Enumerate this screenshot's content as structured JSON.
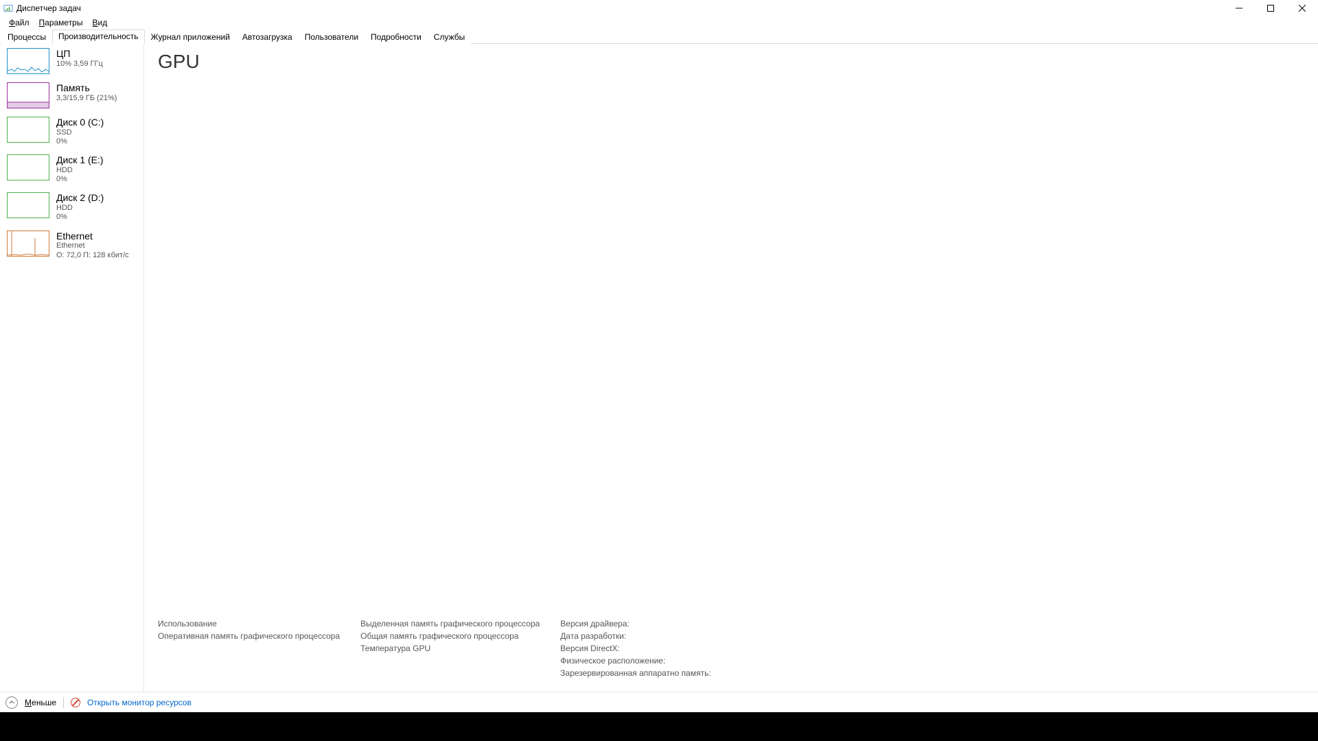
{
  "window": {
    "title": "Диспетчер задач"
  },
  "menu": {
    "file": "Файл",
    "options": "Параметры",
    "view": "Вид"
  },
  "tabs": [
    {
      "label": "Процессы"
    },
    {
      "label": "Производительность"
    },
    {
      "label": "Журнал приложений"
    },
    {
      "label": "Автозагрузка"
    },
    {
      "label": "Пользователи"
    },
    {
      "label": "Подробности"
    },
    {
      "label": "Службы"
    }
  ],
  "activeTab": 1,
  "sidebar": [
    {
      "name": "ЦП",
      "sub1": "10%  3,59 ГГц",
      "type": "cpu"
    },
    {
      "name": "Память",
      "sub1": "3,3/15,9 ГБ (21%)",
      "type": "mem"
    },
    {
      "name": "Диск 0 (C:)",
      "sub1": "SSD",
      "sub2": "0%",
      "type": "disk"
    },
    {
      "name": "Диск 1 (E:)",
      "sub1": "HDD",
      "sub2": "0%",
      "type": "disk"
    },
    {
      "name": "Диск 2 (D:)",
      "sub1": "HDD",
      "sub2": "0%",
      "type": "disk"
    },
    {
      "name": "Ethernet",
      "sub1": "Ethernet",
      "sub2": "О: 72,0  П: 128 кбит/с",
      "type": "net"
    }
  ],
  "main": {
    "heading": "GPU"
  },
  "details": {
    "col1": [
      "Использование",
      "Оперативная память графического процессора"
    ],
    "col2": [
      "Выделенная память графического процессора",
      "Общая память графического процессора",
      "Температура GPU"
    ],
    "col3": [
      "Версия драйвера:",
      "Дата разработки:",
      "Версия DirectX:",
      "Физическое расположение:",
      "Зарезервированная аппаратно память:"
    ]
  },
  "footer": {
    "less": "Меньше",
    "resourceMonitor": "Открыть монитор ресурсов"
  }
}
